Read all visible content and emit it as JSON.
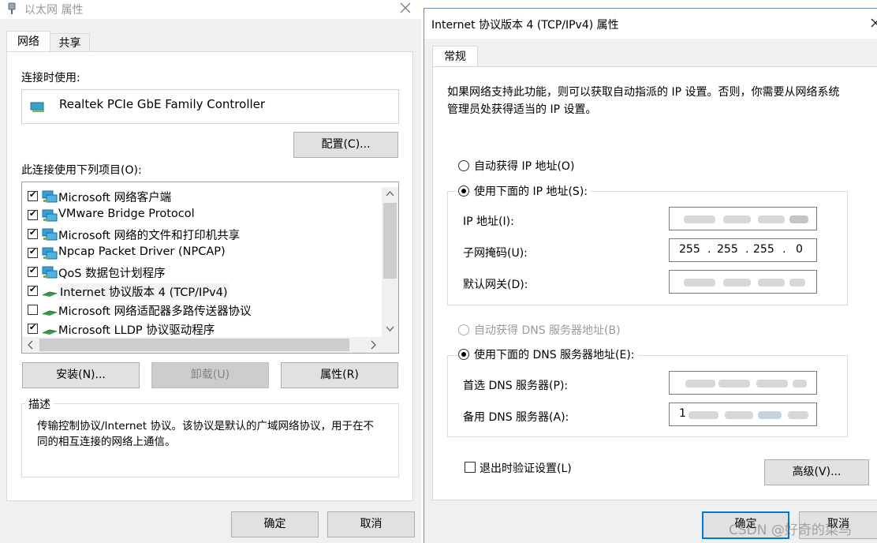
{
  "ethernet": {
    "title": "以太网 属性",
    "tabs": [
      "网络",
      "共享"
    ],
    "connect_using_label": "连接时使用:",
    "adapter_name": "Realtek PCIe GbE Family Controller",
    "configure_button": "配置(C)...",
    "items_label": "此连接使用下列项目(O):",
    "items": [
      {
        "label": "Microsoft 网络客户端",
        "checked": true,
        "icon": "network-client-icon"
      },
      {
        "label": "VMware Bridge Protocol",
        "checked": true,
        "icon": "network-client-icon"
      },
      {
        "label": "Microsoft 网络的文件和打印机共享",
        "checked": true,
        "icon": "network-client-icon"
      },
      {
        "label": "Npcap Packet Driver (NPCAP)",
        "checked": true,
        "icon": "network-client-icon"
      },
      {
        "label": "QoS 数据包计划程序",
        "checked": true,
        "icon": "network-client-icon"
      },
      {
        "label": "Internet 协议版本 4 (TCP/IPv4)",
        "checked": true,
        "icon": "protocol-icon"
      },
      {
        "label": "Microsoft 网络适配器多路传送器协议",
        "checked": false,
        "icon": "protocol-icon"
      },
      {
        "label": "Microsoft LLDP 协议驱动程序",
        "checked": true,
        "icon": "protocol-icon"
      }
    ],
    "install_button": "安装(N)...",
    "uninstall_button": "卸载(U)",
    "properties_button": "属性(R)",
    "description_label": "描述",
    "description_text": "传输控制协议/Internet 协议。该协议是默认的广域网络协议，用于在不同的相互连接的网络上通信。",
    "ok_button": "确定",
    "cancel_button": "取消"
  },
  "ipv4": {
    "title": "Internet 协议版本 4 (TCP/IPv4) 属性",
    "tab": "常规",
    "intro": "如果网络支持此功能，则可以获取自动指派的 IP 设置。否则，你需要从网络系统管理员处获得适当的 IP 设置。",
    "auto_ip_label": "自动获得 IP 地址(O)",
    "manual_ip_label": "使用下面的 IP 地址(S):",
    "ip_address_label": "IP 地址(I):",
    "subnet_label": "子网掩码(U):",
    "subnet_octets": [
      "255",
      "255",
      "255",
      "0"
    ],
    "gateway_label": "默认网关(D):",
    "auto_dns_label": "自动获得 DNS 服务器地址(B)",
    "manual_dns_label": "使用下面的 DNS 服务器地址(E):",
    "preferred_dns_label": "首选 DNS 服务器(P):",
    "alternate_dns_label": "备用 DNS 服务器(A):",
    "alternate_dns_visible": "1",
    "validate_label": "退出时验证设置(L)",
    "advanced_button": "高级(V)...",
    "ok_button": "确定",
    "cancel_button": "取消"
  },
  "watermark": "CSDN @好奇的菜鸟"
}
